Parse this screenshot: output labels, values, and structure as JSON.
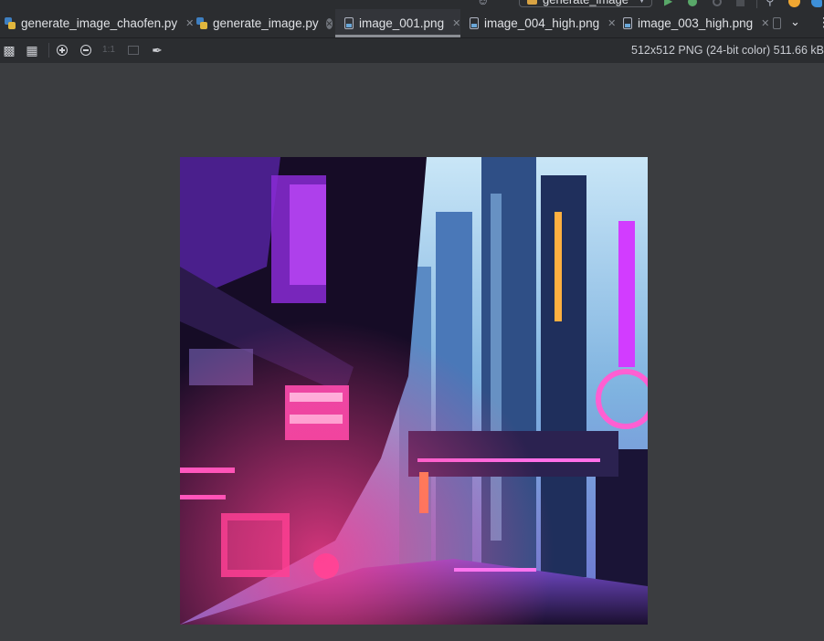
{
  "run_toolbar": {
    "configuration": "generate_image",
    "icons": [
      "profile-icon",
      "run-icon",
      "debug-icon",
      "coverage-icon",
      "stop-icon",
      "search-icon",
      "update-icon",
      "plugin-icon"
    ]
  },
  "tabs": [
    {
      "label": "generate_image_chaofen.py",
      "icon": "python-file-icon",
      "active": false
    },
    {
      "label": "generate_image.py",
      "icon": "python-file-icon",
      "active": false
    },
    {
      "label": "image_001.png",
      "icon": "image-file-icon",
      "active": true
    },
    {
      "label": "image_004_high.png",
      "icon": "image-file-icon",
      "active": false
    },
    {
      "label": "image_003_high.png",
      "icon": "image-file-icon",
      "active": false
    }
  ],
  "image_toolbar": {
    "actual_size_label": "1:1",
    "buttons": [
      "chessboard-icon",
      "grid-icon",
      "zoom-in-icon",
      "zoom-out-icon",
      "actual-size-icon",
      "fit-icon",
      "color-picker-icon"
    ],
    "info": "512x512 PNG (24-bit color) 511.66 kB"
  },
  "image": {
    "description_colors": {
      "neon_pink": "#ff3fa8",
      "neon_purple": "#b44dff",
      "sky_blue": "#8ec3f0",
      "dark": "#140c22"
    }
  },
  "colors": {
    "chrome_bg": "#2b2d30",
    "viewer_bg": "#3b3d40",
    "run_green": "#59a869"
  }
}
